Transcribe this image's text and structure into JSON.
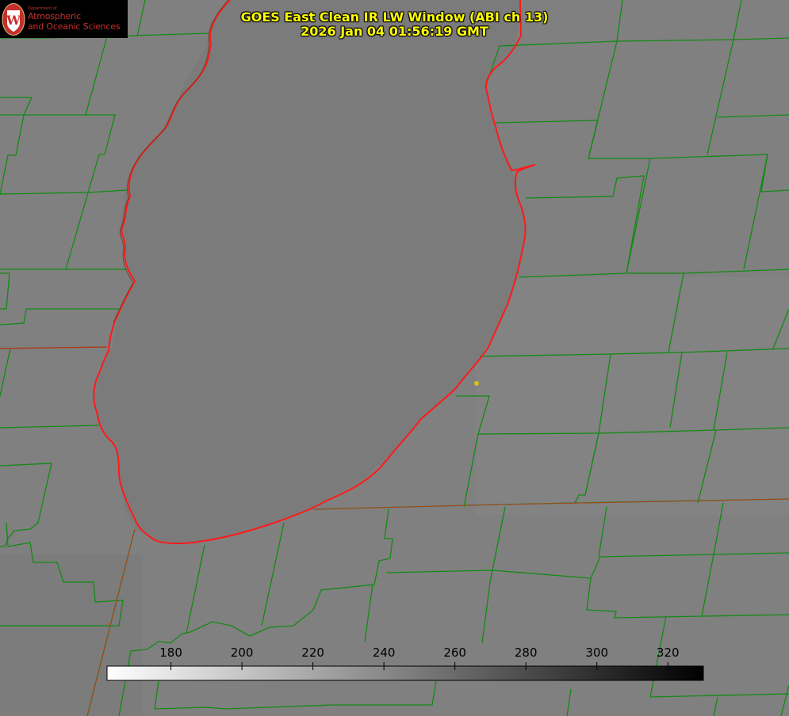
{
  "logo": {
    "department": "Department of",
    "line1": "Atmospheric",
    "line2": "and Oceanic Sciences",
    "seal_letter": "W"
  },
  "title": {
    "line1": "GOES East Clean IR LW Window (ABI ch 13)",
    "line2": "2026 Jan 04 01:56:19 GMT"
  },
  "colorbar": {
    "ticks": [
      "180",
      "200",
      "220",
      "240",
      "260",
      "280",
      "300",
      "320"
    ],
    "min": 162,
    "max": 330,
    "gradient": "white-to-black"
  },
  "colors": {
    "background": "#808080",
    "lake": "#7d7d7d",
    "county_lines": "#138a13",
    "coastline": "#ff1a1a",
    "title_text": "#ffff00",
    "marker": "#d4c21a"
  },
  "icons": {
    "logo": "uw-crest-icon",
    "marker": "location-dot-icon"
  }
}
